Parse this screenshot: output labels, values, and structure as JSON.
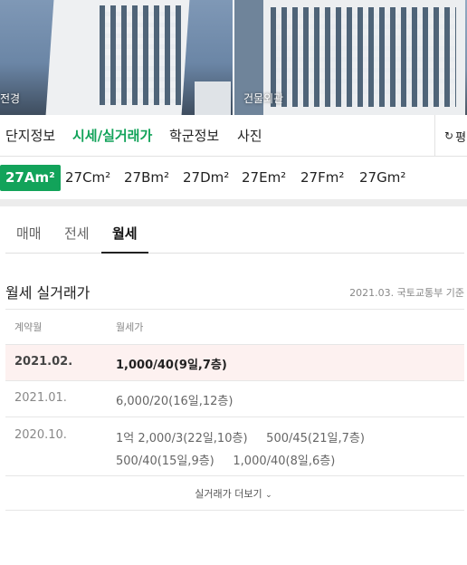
{
  "photos": [
    {
      "caption": "전경"
    },
    {
      "caption": "건물외관"
    }
  ],
  "main_tabs": [
    {
      "label": "단지정보",
      "active": false
    },
    {
      "label": "시세/실거래가",
      "active": true
    },
    {
      "label": "학군정보",
      "active": false
    },
    {
      "label": "사진",
      "active": false
    }
  ],
  "refresh": {
    "icon": "refresh-icon",
    "label": "평"
  },
  "types": [
    {
      "label": "27Am²",
      "active": true
    },
    {
      "label": "27Cm²",
      "active": false
    },
    {
      "label": "27Bm²",
      "active": false
    },
    {
      "label": "27Dm²",
      "active": false
    },
    {
      "label": "27Em²",
      "active": false
    },
    {
      "label": "27Fm²",
      "active": false
    },
    {
      "label": "27Gm²",
      "active": false
    }
  ],
  "deal_tabs": [
    {
      "label": "매매",
      "active": false
    },
    {
      "label": "전세",
      "active": false
    },
    {
      "label": "월세",
      "active": true
    }
  ],
  "section": {
    "title": "월세 실거래가",
    "source": "2021.03. 국토교통부 기준"
  },
  "table": {
    "headers": [
      "계약월",
      "월세가"
    ],
    "rows": [
      {
        "date": "2021.02.",
        "lines": [
          "1,000/40(9일,7층)"
        ],
        "highlight": true
      },
      {
        "date": "2021.01.",
        "lines": [
          "6,000/20(16일,12층)"
        ],
        "highlight": false
      },
      {
        "date": "2020.10.",
        "lines": [
          "1억 2,000/3(22일,10층)     500/45(21일,7층)",
          "500/40(15일,9층)     1,000/40(8일,6층)"
        ],
        "highlight": false
      }
    ]
  },
  "more": {
    "label": "실거래가 더보기",
    "icon": "chevron-down-icon"
  },
  "colors": {
    "accent": "#12a35a",
    "highlight_row": "#fdf1f0"
  }
}
